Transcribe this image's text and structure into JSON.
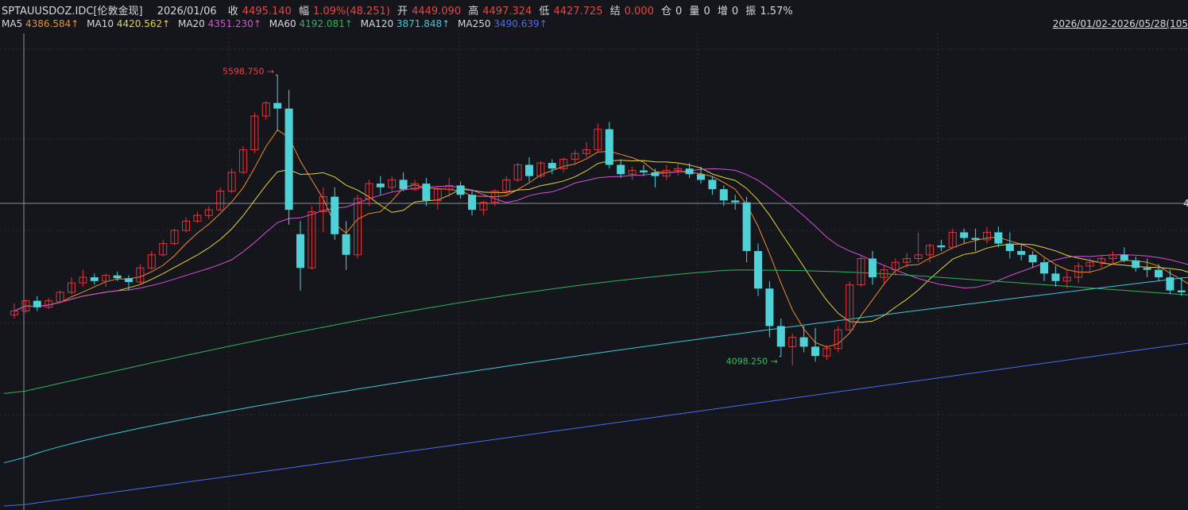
{
  "header": {
    "symbol": "SPTAUUSDOZ.IDC[伦敦金现]",
    "date": "2026/01/06",
    "close_label": "收",
    "close": "4495.140",
    "change_label": "幅",
    "change": "1.09%(48.251)",
    "open_label": "开",
    "open": "4449.090",
    "high_label": "高",
    "high": "4497.324",
    "low_label": "低",
    "low": "4427.725",
    "settle_label": "结",
    "settle": "0.000",
    "oi_label": "仓",
    "oi": "0",
    "vol_label": "量",
    "vol": "0",
    "inc_label": "增",
    "inc": "0",
    "amp_label": "振",
    "amp": "1.57%"
  },
  "ma_legend": [
    {
      "name": "MA5",
      "value": "4386.584↑",
      "color": "#e8e8e8",
      "value_color": "#f08c2a"
    },
    {
      "name": "MA10",
      "value": "4420.562↑",
      "color": "#e8e8e8",
      "value_color": "#e8d23a"
    },
    {
      "name": "MA20",
      "value": "4351.230↑",
      "color": "#e8e8e8",
      "value_color": "#d94fd9"
    },
    {
      "name": "MA60",
      "value": "4192.081↑",
      "color": "#e8e8e8",
      "value_color": "#2fb35a"
    },
    {
      "name": "MA120",
      "value": "3871.848↑",
      "color": "#e8e8e8",
      "value_color": "#3ec8d8"
    },
    {
      "name": "MA250",
      "value": "3490.639↑",
      "color": "#e8e8e8",
      "value_color": "#4a6cf0"
    }
  ],
  "range": "2026/01/02-2026/05/28(105",
  "y_edge_label": "4",
  "colors": {
    "up": "#e0353b",
    "down": "#4fd1d8",
    "bg": "#14161c",
    "grid": "#2a2e38",
    "ma5": "#f08c2a",
    "ma10": "#e8d23a",
    "ma20": "#d94fd9",
    "ma60": "#2fb35a",
    "ma120": "#3ec8d8",
    "ma250": "#4a6cf0"
  },
  "chart_data": {
    "type": "candlestick",
    "y_range": [
      3300,
      5800
    ],
    "annotations": [
      {
        "label": "5598.750",
        "type": "high"
      },
      {
        "label": "4098.250",
        "type": "low"
      }
    ],
    "ohlc": [
      [
        4320,
        4380,
        4300,
        4340
      ],
      [
        4340,
        4400,
        4330,
        4395
      ],
      [
        4395,
        4420,
        4340,
        4360
      ],
      [
        4360,
        4410,
        4350,
        4395
      ],
      [
        4390,
        4450,
        4380,
        4440
      ],
      [
        4440,
        4520,
        4430,
        4490
      ],
      [
        4490,
        4560,
        4470,
        4520
      ],
      [
        4520,
        4540,
        4480,
        4500
      ],
      [
        4500,
        4540,
        4470,
        4530
      ],
      [
        4530,
        4550,
        4500,
        4515
      ],
      [
        4515,
        4530,
        4450,
        4495
      ],
      [
        4495,
        4590,
        4480,
        4570
      ],
      [
        4570,
        4660,
        4560,
        4640
      ],
      [
        4640,
        4720,
        4630,
        4700
      ],
      [
        4700,
        4780,
        4690,
        4770
      ],
      [
        4770,
        4840,
        4760,
        4820
      ],
      [
        4820,
        4870,
        4810,
        4850
      ],
      [
        4850,
        4900,
        4830,
        4880
      ],
      [
        4880,
        5000,
        4870,
        4980
      ],
      [
        4980,
        5100,
        4970,
        5080
      ],
      [
        5080,
        5220,
        5070,
        5200
      ],
      [
        5200,
        5400,
        5180,
        5380
      ],
      [
        5380,
        5460,
        5360,
        5450
      ],
      [
        5450,
        5598.75,
        5300,
        5420
      ],
      [
        5420,
        5520,
        4800,
        4880
      ],
      [
        4750,
        4820,
        4450,
        4570
      ],
      [
        4570,
        4900,
        4560,
        4870
      ],
      [
        4870,
        5000,
        4760,
        4950
      ],
      [
        4950,
        5000,
        4720,
        4750
      ],
      [
        4750,
        4820,
        4560,
        4640
      ],
      [
        4640,
        4960,
        4620,
        4940
      ],
      [
        4940,
        5040,
        4900,
        5020
      ],
      [
        5020,
        5060,
        4960,
        5000
      ],
      [
        5000,
        5060,
        4980,
        5040
      ],
      [
        5040,
        5080,
        4980,
        4990
      ],
      [
        4990,
        5040,
        4980,
        5020
      ],
      [
        5020,
        5050,
        4900,
        4930
      ],
      [
        4930,
        5000,
        4880,
        4990
      ],
      [
        4990,
        5050,
        4950,
        5010
      ],
      [
        5010,
        5030,
        4940,
        4960
      ],
      [
        4960,
        4990,
        4850,
        4880
      ],
      [
        4880,
        4930,
        4850,
        4920
      ],
      [
        4920,
        4990,
        4900,
        4980
      ],
      [
        4980,
        5060,
        4960,
        5040
      ],
      [
        5040,
        5130,
        5030,
        5120
      ],
      [
        5120,
        5160,
        5030,
        5060
      ],
      [
        5060,
        5140,
        5050,
        5130
      ],
      [
        5130,
        5150,
        5070,
        5100
      ],
      [
        5100,
        5160,
        5080,
        5150
      ],
      [
        5150,
        5200,
        5120,
        5180
      ],
      [
        5180,
        5240,
        5160,
        5200
      ],
      [
        5200,
        5340,
        5190,
        5310
      ],
      [
        5310,
        5350,
        5100,
        5120
      ],
      [
        5120,
        5150,
        5050,
        5070
      ],
      [
        5070,
        5110,
        5040,
        5090
      ],
      [
        5090,
        5120,
        5060,
        5080
      ],
      [
        5080,
        5100,
        5000,
        5060
      ],
      [
        5060,
        5120,
        5040,
        5090
      ],
      [
        5090,
        5130,
        5060,
        5100
      ],
      [
        5100,
        5130,
        5050,
        5070
      ],
      [
        5070,
        5110,
        5020,
        5040
      ],
      [
        5040,
        5060,
        4960,
        4990
      ],
      [
        4990,
        5010,
        4900,
        4930
      ],
      [
        4930,
        4960,
        4880,
        4920
      ],
      [
        4920,
        4950,
        4600,
        4660
      ],
      [
        4660,
        4700,
        4420,
        4460
      ],
      [
        4460,
        4500,
        4200,
        4260
      ],
      [
        4260,
        4300,
        4098.25,
        4150
      ],
      [
        4150,
        4220,
        4050,
        4200
      ],
      [
        4200,
        4260,
        4120,
        4150
      ],
      [
        4150,
        4250,
        4070,
        4100
      ],
      [
        4100,
        4160,
        4080,
        4140
      ],
      [
        4140,
        4260,
        4120,
        4240
      ],
      [
        4240,
        4500,
        4230,
        4480
      ],
      [
        4480,
        4640,
        4470,
        4620
      ],
      [
        4620,
        4660,
        4480,
        4520
      ],
      [
        4520,
        4580,
        4480,
        4560
      ],
      [
        4560,
        4620,
        4530,
        4600
      ],
      [
        4600,
        4650,
        4570,
        4620
      ],
      [
        4620,
        4760,
        4600,
        4640
      ],
      [
        4640,
        4700,
        4600,
        4690
      ],
      [
        4690,
        4720,
        4660,
        4680
      ],
      [
        4680,
        4780,
        4670,
        4760
      ],
      [
        4760,
        4780,
        4700,
        4730
      ],
      [
        4730,
        4780,
        4660,
        4720
      ],
      [
        4720,
        4790,
        4700,
        4760
      ],
      [
        4760,
        4790,
        4680,
        4700
      ],
      [
        4700,
        4760,
        4620,
        4660
      ],
      [
        4660,
        4700,
        4610,
        4640
      ],
      [
        4640,
        4660,
        4570,
        4600
      ],
      [
        4600,
        4620,
        4500,
        4540
      ],
      [
        4540,
        4580,
        4470,
        4500
      ],
      [
        4500,
        4560,
        4460,
        4520
      ],
      [
        4520,
        4600,
        4490,
        4580
      ],
      [
        4580,
        4620,
        4540,
        4600
      ],
      [
        4600,
        4640,
        4570,
        4620
      ],
      [
        4620,
        4660,
        4590,
        4640
      ],
      [
        4640,
        4680,
        4600,
        4610
      ],
      [
        4610,
        4630,
        4550,
        4570
      ],
      [
        4570,
        4620,
        4520,
        4560
      ],
      [
        4560,
        4590,
        4500,
        4520
      ],
      [
        4520,
        4560,
        4430,
        4450
      ],
      [
        4450,
        4520,
        4420,
        4440
      ],
      [
        4440,
        4470,
        4360,
        4380
      ],
      [
        4380,
        4420,
        4350,
        4390
      ]
    ]
  }
}
